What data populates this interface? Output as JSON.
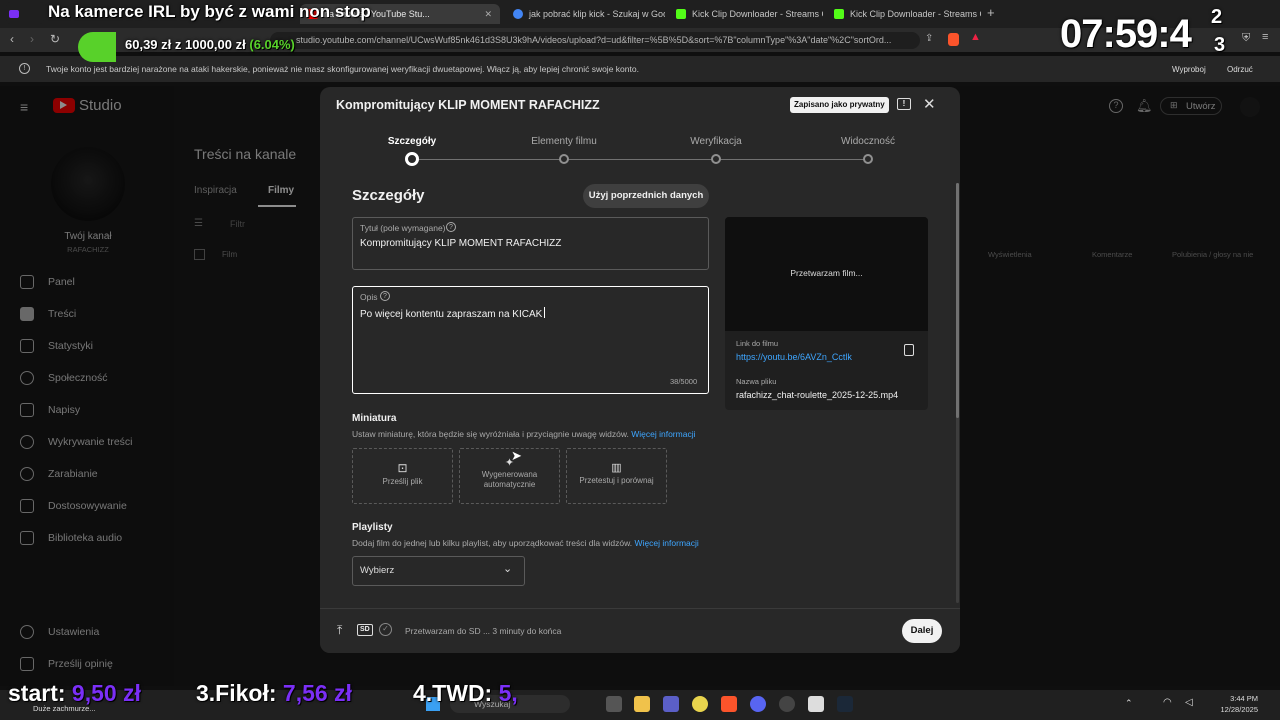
{
  "overlay": {
    "stream_title": "Na kamerce IRL by być z wami non stop",
    "goal_current": "60,39 zł",
    "goal_connector": "z",
    "goal_target": "1000,00 zł",
    "goal_percent": "(6.04%)",
    "goal_progress": 0.0604,
    "clock": "07:59:4",
    "clock_tail_top": "2",
    "clock_tail_bottom": "3",
    "leaderboard": [
      {
        "label": "start:",
        "amount": "9,50 zł"
      },
      {
        "label": "3.Fikoł:",
        "amount": "7,56 zł"
      },
      {
        "label": "4.TWD:",
        "amount": "5,"
      }
    ],
    "colors": {
      "amount": "#7b2ff7",
      "goal_bar": "#58d12a"
    }
  },
  "browser": {
    "tabs": [
      {
        "label": "na kanale - YouTube Stu...",
        "active": true
      },
      {
        "label": "jak pobrać klip kick - Szukaj w Goog",
        "active": false
      },
      {
        "label": "Kick Clip Downloader - Streams Cha",
        "active": false
      },
      {
        "label": "Kick Clip Downloader - Streams Cha",
        "active": false
      }
    ],
    "new_tab": "+",
    "url": "studio.youtube.com/channel/UCwsWuf85nk461d3S8U3k9hA/videos/upload?d=ud&filter=%5B%5D&sort=%7B\"columnType\"%3A\"date\"%2C\"sortOrd...",
    "warning": "Twoje konto jest bardziej narażone na ataki hakerskie, ponieważ nie masz skonfigurowanej weryfikacji dwuetapowej. Włącz ją, aby lepiej chronić swoje konto.",
    "warning_actions": [
      "Wyproboj",
      "Odrzuć"
    ]
  },
  "studio": {
    "logo": "Studio",
    "create_label": "Utwórz",
    "channel_name": "Twój kanał",
    "channel_handle": "RAFACHIZZ",
    "page_title": "Treści na kanale",
    "tabs": [
      "Inspiracja",
      "Filmy"
    ],
    "filter_placeholder": "Filtr",
    "col_film": "Film",
    "col_headers": [
      "Wyświetlenia",
      "Komentarze",
      "Polubienia / głosy na nie"
    ],
    "nav": [
      "Panel",
      "Treści",
      "Statystyki",
      "Społeczność",
      "Napisy",
      "Wykrywanie treści",
      "Zarabianie",
      "Dostosowywanie",
      "Biblioteka audio"
    ],
    "nav_bottom": [
      "Ustawienia",
      "Prześlij opinię"
    ]
  },
  "dialog": {
    "title": "Kompromitujący KLIP MOMENT RAFACHIZZ",
    "saved_badge": "Zapisano jako prywatny",
    "steps": [
      "Szczegóły",
      "Elementy filmu",
      "Weryfikacja",
      "Widoczność"
    ],
    "section_title": "Szczegóły",
    "reuse_button": "Użyj poprzednich danych",
    "title_field": {
      "label": "Tytuł (pole wymagane)",
      "value": "Kompromitujący KLIP MOMENT RAFACHIZZ"
    },
    "desc_field": {
      "label": "Opis",
      "value": "Po więcej kontentu zapraszam na KICAK",
      "counter": "38/5000"
    },
    "preview": {
      "processing": "Przetwarzam film...",
      "link_label": "Link do filmu",
      "link": "https://youtu.be/6AVZn_Cctlk",
      "filename_label": "Nazwa pliku",
      "filename": "rafachizz_chat-roulette_2025-12-25.mp4"
    },
    "thumbnail": {
      "title": "Miniatura",
      "subtitle": "Ustaw miniaturę, która będzie się wyróżniała i przyciągnie uwagę widzów.",
      "more": "Więcej informacji",
      "options": [
        "Prześlij plik",
        "Wygenerowana automatycznie",
        "Przetestuj i porównaj"
      ]
    },
    "playlists": {
      "title": "Playlisty",
      "subtitle": "Dodaj film do jednej lub kilku playlist, aby uporządkować treści dla widzów.",
      "more": "Więcej informacji",
      "select": "Wybierz"
    },
    "footer": {
      "status": "Przetwarzam do SD ... 3 minuty do końca",
      "sd": "SD",
      "next": "Dalej"
    }
  },
  "taskbar": {
    "search": "Wyszukaj",
    "time": "3:44 PM",
    "date": "12/28/2025",
    "notice": "Duże zachmurze..."
  }
}
